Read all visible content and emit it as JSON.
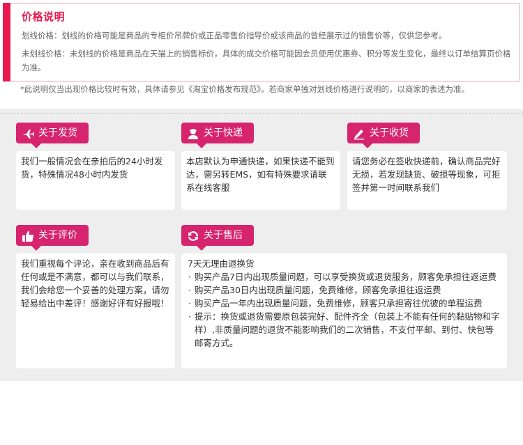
{
  "price": {
    "title": "价格说明",
    "line1": "划线价格：划线的价格可能是商品的专柜价吊牌价或正品零售价指导价或该商品的曾经展示过的销售价等，仅供您参考。",
    "line2": "未划线价格：未划线的价格是商品在天猫上的销售标价，具体的成交价格可能因会员使用优惠券、积分等发生变化，最终以订单结算页价格为准。",
    "note": "*此说明仅当出现价格比较时有效，具体请参见《淘宝价格发布规范》。若商家单独对划线价格进行说明的，以商家的表述为准。"
  },
  "cards": {
    "shipping": {
      "title": "关于发货",
      "icon": "airplane-icon",
      "body": "我们一般情况会在亲拍后的24小时发货，特殊情况48小时内发货"
    },
    "express": {
      "title": "关于快递",
      "icon": "courier-icon",
      "body": "本店默认为申通快递，如果快递不能到达，需另转EMS，如有特殊要求请联系在线客服"
    },
    "receiving": {
      "title": "关于收货",
      "icon": "pen-icon",
      "body": "请您务必在签收快递前，确认商品完好无损，若发现缺货、破损等现象，可拒签并第一时间联系我们"
    },
    "review": {
      "title": "关于评价",
      "icon": "thumbs-up-icon",
      "body": "我们重视每个评论，亲在收到商品后有任何或是不满意，都可以与我们联系，我们会给您一个妥善的处理方案，请勿轻易给出中差评！感谢好评有好报哦！"
    },
    "aftersale": {
      "title": "关于售后",
      "icon": "refresh-icon",
      "lines": [
        "7天无理由退换货",
        "购买产品7日内出现质量问题，可以享受换货或退货服务，顾客免承担往返运费",
        "购买产品30日内出现质量问题，免费维修，顾客免承担往返运费",
        "购买产品一年内出现质量问题，免费维修，顾客只承担寄往优彼的单程运费",
        "提示：换货或退货需要原包装完好、配件齐全（包装上不能有任何的黏贴物和字样）,非质量问题的退货不能影响我们的二次销售，不支付平邮、到付、快包等邮寄方式。"
      ]
    }
  },
  "colors": {
    "accent": "#e8194e",
    "card_title": "#d6246e",
    "panel_bg": "#eeeeee"
  }
}
